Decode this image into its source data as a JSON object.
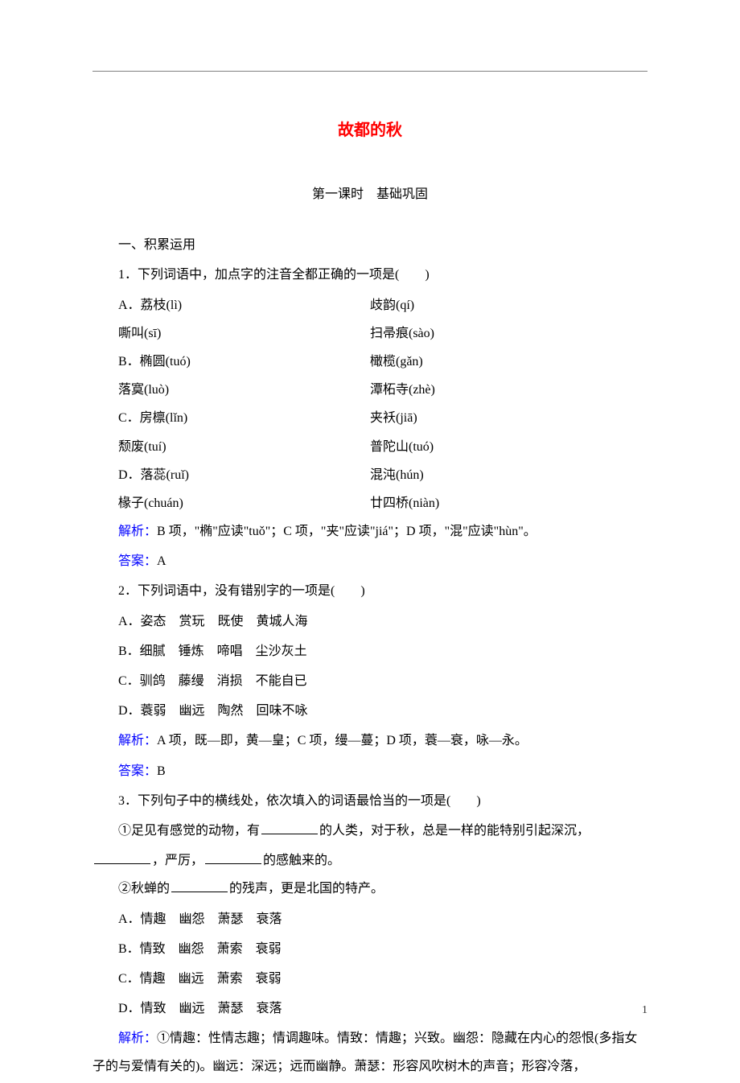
{
  "title": "故都的秋",
  "subtitle": "第一课时　基础巩固",
  "section1": "一、积累运用",
  "q1": {
    "stem": "1．下列词语中，加点字的注音全都正确的一项是(　　)",
    "A1": "A．荔枝(lì)",
    "A2": "歧韵(qí)",
    "A3": "嘶叫(sī)",
    "A4": "扫帚痕(sào)",
    "B1": "B．椭圆(tuó)",
    "B2": "橄榄(gǎn)",
    "B3": "落寞(luò)",
    "B4": "潭柘寺(zhè)",
    "C1": "C．房檩(lǐn)",
    "C2": "夹袄(jiā)",
    "C3": "颓废(tuí)",
    "C4": "普陀山(tuó)",
    "D1": "D．落蕊(ruǐ)",
    "D2": "混沌(hún)",
    "D3": "椽子(chuán)",
    "D4": "廿四桥(niàn)",
    "explain_label": "解析：",
    "explain": "B 项，\"椭\"应读\"tuǒ\"；C 项，\"夹\"应读\"jiá\"；D 项，\"混\"应读\"hùn\"。",
    "answer_label": "答案：",
    "answer": "A"
  },
  "q2": {
    "stem": "2．下列词语中，没有错别字的一项是(　　)",
    "A": "A．姿态　赏玩　既使　黄城人海",
    "B": "B．细腻　锤炼　啼唱　尘沙灰土",
    "C": "C．驯鸽　藤缦　消损　不能自已",
    "D": "D．蓑弱　幽远　陶然　回味不咏",
    "explain_label": "解析：",
    "explain": "A 项，既—即，黄—皇；C 项，缦—蔓；D 项，蓑—衰，咏—永。",
    "answer_label": "答案：",
    "answer": "B"
  },
  "q3": {
    "stem": "3．下列句子中的横线处，依次填入的词语最恰当的一项是(　　)",
    "line1a": "①足见有感觉的动物，有",
    "line1b": "的人类，对于秋，总是一样的能特别引起深沉，",
    "line2a": "，严厉，",
    "line2b": "的感触来的。",
    "line3a": "②秋蝉的",
    "line3b": "的残声，更是北国的特产。",
    "A": "A．情趣　幽怨　萧瑟　衰落",
    "B": "B．情致　幽怨　萧索　衰弱",
    "C": "C．情趣　幽远　萧索　衰弱",
    "D": "D．情致　幽远　萧瑟　衰落",
    "explain_label": "解析：",
    "explain": "①情趣：性情志趣；情调趣味。情致：情趣；兴致。幽怨：隐藏在内心的怨恨(多指女子的与爱情有关的)。幽远：深远；远而幽静。萧瑟：形容风吹树木的声音；形容冷落，"
  },
  "page_number": "1"
}
